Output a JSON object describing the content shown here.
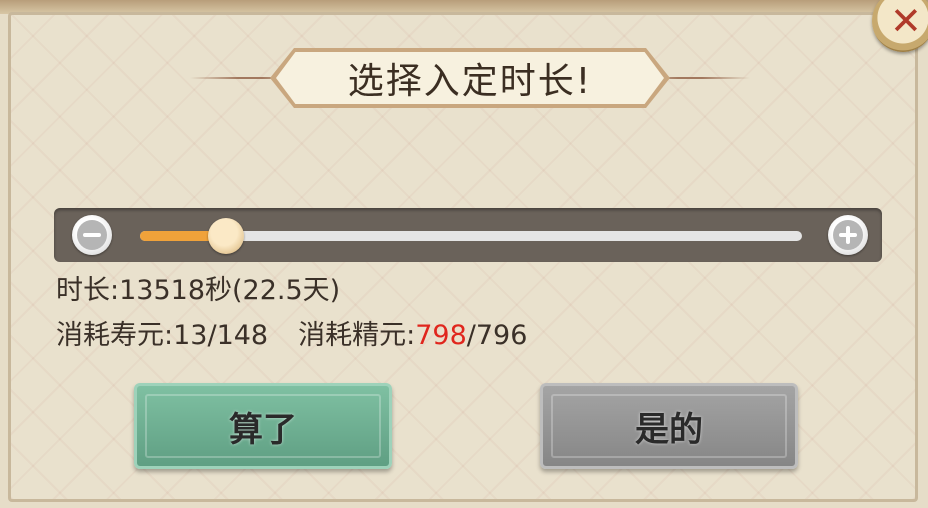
{
  "dialog": {
    "title": "选择入定时长!",
    "close_icon": "close-icon"
  },
  "slider": {
    "value_fraction": 0.13,
    "minus_icon": "minus-circle-icon",
    "plus_icon": "plus-circle-icon",
    "fill_color": "#f0a23a"
  },
  "info": {
    "duration_label": "时长:",
    "duration_value": "13518秒(22.5天)",
    "lifespan_label": "消耗寿元:",
    "lifespan_value": "13/148",
    "essence_label": "消耗精元:",
    "essence_current": "798",
    "essence_sep_total": "/796",
    "warning_color": "#e0261d"
  },
  "buttons": {
    "cancel_label": "算了",
    "confirm_label": "是的"
  }
}
